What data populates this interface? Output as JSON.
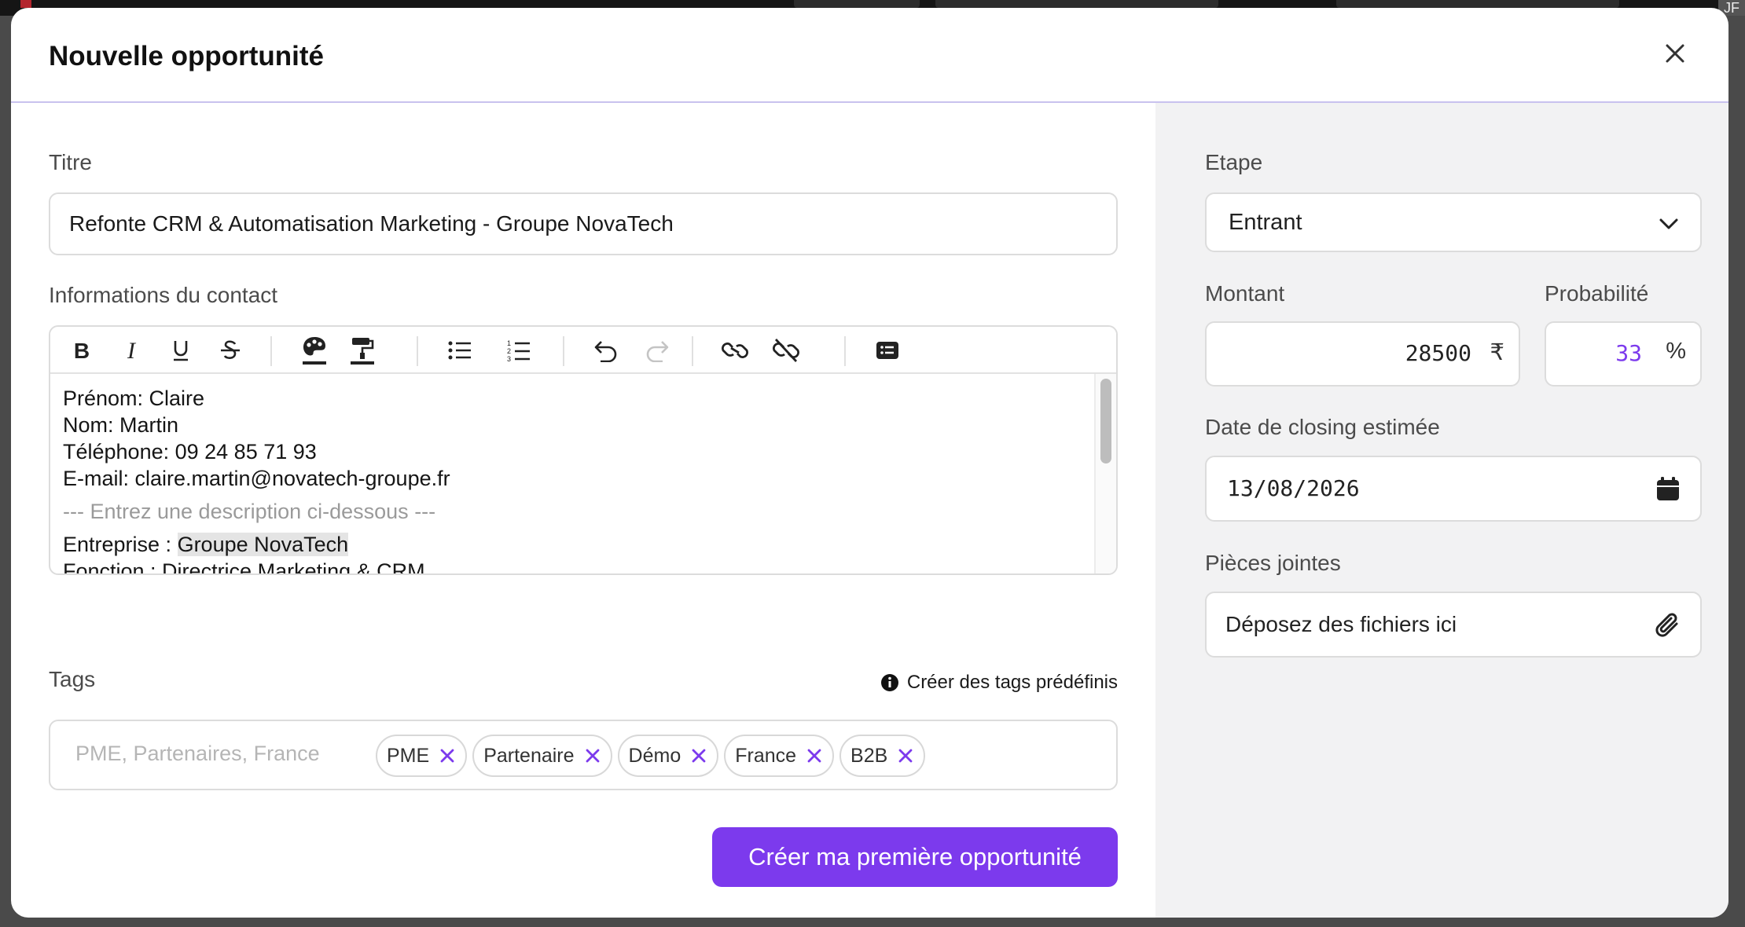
{
  "modal": {
    "title": "Nouvelle opportunité",
    "close_icon": "close-icon"
  },
  "form": {
    "title_label": "Titre",
    "title_value": "Refonte CRM & Automatisation Marketing - Groupe NovaTech",
    "contact_label": "Informations du contact",
    "toolbar_icons": [
      "bold-icon",
      "italic-icon",
      "underline-icon",
      "strikethrough-icon",
      "text-color-icon",
      "highlight-color-icon",
      "bullet-list-icon",
      "numbered-list-icon",
      "undo-icon",
      "redo-icon",
      "link-icon",
      "unlink-icon",
      "insert-field-icon"
    ],
    "contact_lines": {
      "firstname": "Prénom: Claire",
      "lastname": "Nom: Martin",
      "phone": "Téléphone: 09 24 85 71 93",
      "email": "E-mail: claire.martin@novatech-groupe.fr",
      "separator": "--- Entrez une description ci-dessous ---",
      "company_prefix": "Entreprise : ",
      "company_name": "Groupe NovaTech",
      "role": "Fonction : Directrice Marketing & CRM"
    },
    "tags_label": "Tags",
    "tags_help": "Créer des tags prédéfinis",
    "tags_placeholder": "PME, Partenaires, France",
    "tags": [
      "PME",
      "Partenaire",
      "Démo",
      "France",
      "B2B"
    ],
    "submit_label": "Créer ma première opportunité"
  },
  "sidebar": {
    "stage_label": "Etape",
    "stage_value": "Entrant",
    "amount_label": "Montant",
    "amount_value": "28500",
    "currency_symbol": "₹",
    "probability_label": "Probabilité",
    "probability_value": "33",
    "probability_unit": "%",
    "closing_label": "Date de closing estimée",
    "closing_value": "13/08/2026",
    "attachments_label": "Pièces jointes",
    "attachments_placeholder": "Déposez des fichiers ici"
  },
  "background": {
    "avatar_initials": "JF"
  },
  "colors": {
    "accent": "#7c3aed",
    "header_divider": "#c9c2ee",
    "sidebar_bg": "#f2f2f3"
  }
}
